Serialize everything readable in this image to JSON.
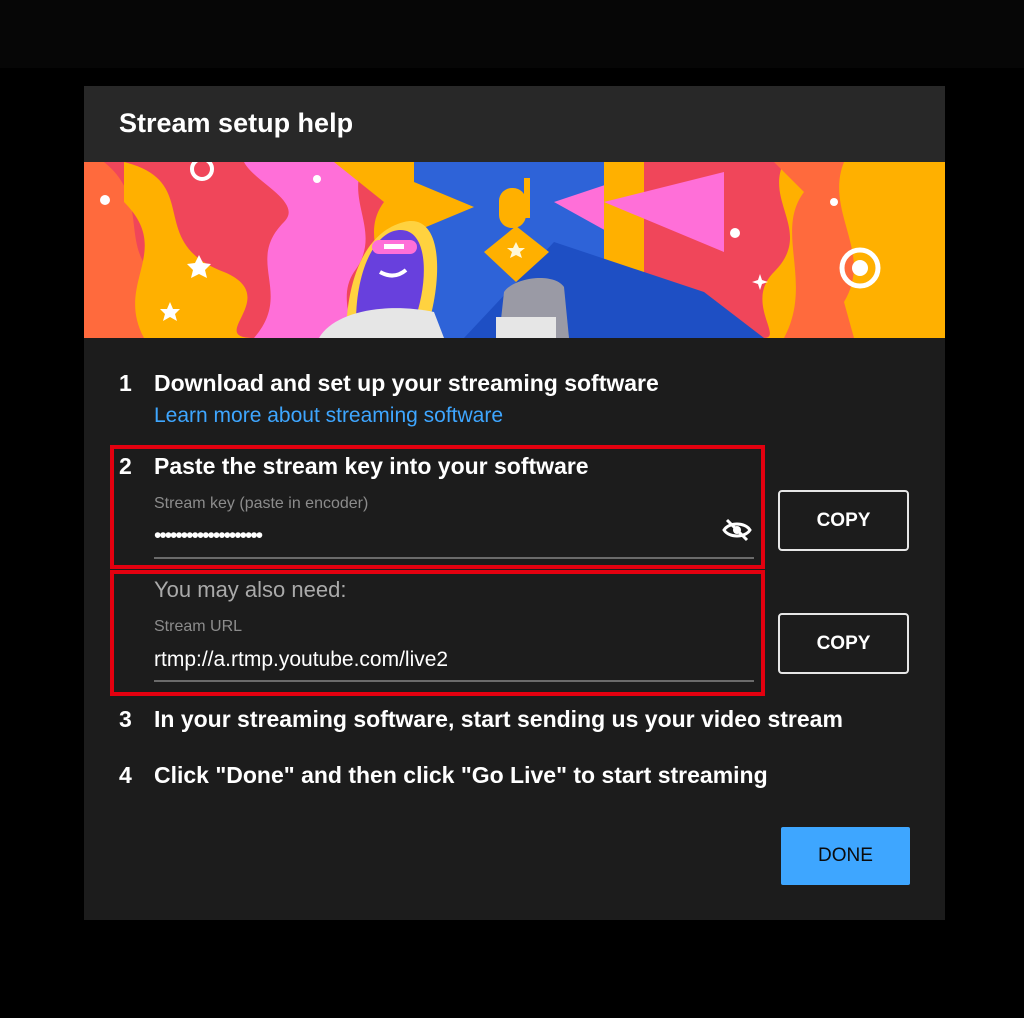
{
  "dialog": {
    "title": "Stream setup help"
  },
  "banner": {
    "icon": "stream-key-illustration"
  },
  "steps": [
    {
      "number": "1",
      "text": "Download and set up your streaming software",
      "link": "Learn more about streaming software"
    },
    {
      "number": "2",
      "text": "Paste the stream key into your software"
    },
    {
      "number": "3",
      "text": "In your streaming software, start sending us your video stream"
    },
    {
      "number": "4",
      "text": "Click \"Done\" and then click \"Go Live\" to start streaming"
    }
  ],
  "stream_key": {
    "label": "Stream key (paste in encoder)",
    "value": "••••••••••••••••••••",
    "toggle_icon": "eye-off-icon",
    "copy_label": "COPY"
  },
  "also_need": "You may also need:",
  "stream_url": {
    "label": "Stream URL",
    "value": "rtmp://a.rtmp.youtube.com/live2",
    "copy_label": "COPY"
  },
  "done_label": "DONE",
  "colors": {
    "accent": "#3ea6ff",
    "highlight": "#e3000f",
    "dialog_bg": "#1c1c1c"
  }
}
